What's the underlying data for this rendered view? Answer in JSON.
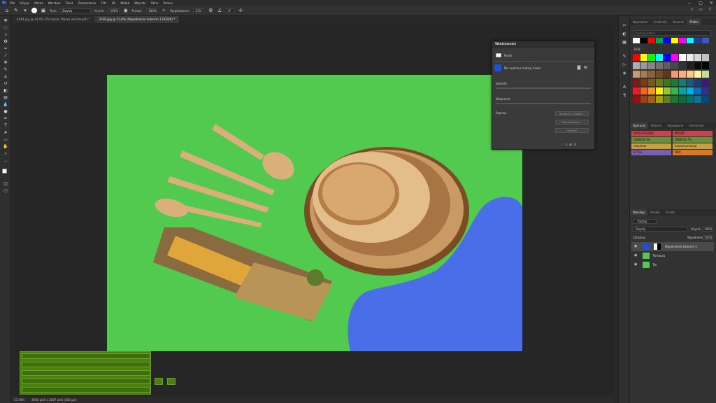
{
  "menubar": {
    "logo": "Ps",
    "items": [
      "Plik",
      "Edycja",
      "Obraz",
      "Warstwa",
      "Tekst",
      "Zaznaczenie",
      "Filtr",
      "3D",
      "Widok",
      "Wtyczki",
      "Okno",
      "Pomoc"
    ]
  },
  "window_controls": {
    "minimize": "—",
    "maximize": "▢",
    "close": "✕"
  },
  "options": {
    "tryb_label": "Tryb:",
    "tryb_value": "Zwykły",
    "krycie_label": "Krycie:",
    "krycie_value": "100%",
    "przeplyw_label": "Przepł.:",
    "przeplyw_value": "100%",
    "wygladzanie_label": "Wygładzanie:",
    "wygladzanie_value": "21%",
    "angle_value": "0°"
  },
  "tabs": [
    "4484.jpg @ 44,9% (Tło kopia, Maska warstwy/8) *",
    "3538.jpg @ 53,6% (Wypełnienie kolorem 1,RGB/8) *"
  ],
  "statusbar": {
    "zoom": "53,56%",
    "size": "4000 pikS x 2667 pikS (300 ppi)"
  },
  "properties": {
    "title": "Właściwości",
    "subtitle": "Maski",
    "mask_label": "Nie wybrano żadnej maski",
    "gestosc_label": "Gęstość:",
    "wtapianie_label": "Wtapianie:",
    "popraw_label": "Popraw:",
    "btn_zaznacz": "Zaznacz i maskuj...",
    "btn_zakres": "Zakres koloru...",
    "btn_odwroc": "Odwróć"
  },
  "swatches_panel": {
    "tabs": [
      "Najnowsze",
      "Próbki",
      "Gradienty",
      "Desenie"
    ],
    "active_tab": "Próbki",
    "search_placeholder": "Szukaj próbek",
    "group_label": "RGB",
    "top_colors": [
      "#ffffff",
      "#000000",
      "#ff0000",
      "#00a650",
      "#0000ff",
      "#ffff00",
      "#ff00ff",
      "#00ffff",
      "#1a3ea8",
      "#3a56c7"
    ],
    "grid_colors": [
      "#ff0000",
      "#ffff00",
      "#00ff00",
      "#00ffff",
      "#0000ff",
      "#ff00ff",
      "#ffffff",
      "#ebebeb",
      "#d6d6d6",
      "#c2c2c2",
      "#adadad",
      "#999999",
      "#858585",
      "#707070",
      "#5c5c5c",
      "#474747",
      "#333333",
      "#1f1f1f",
      "#0a0a0a",
      "#000000",
      "#c69c6d",
      "#a67c52",
      "#8c6239",
      "#754c24",
      "#603913",
      "#f7977a",
      "#f9ad81",
      "#fdc68a",
      "#fff79a",
      "#c4df9b",
      "#7a1b1b",
      "#7a3b1b",
      "#7a5a1b",
      "#6b7a1b",
      "#3b7a1b",
      "#1b7a3b",
      "#1b7a6b",
      "#1b5a7a",
      "#1b3b7a",
      "#3b1b7a",
      "#ed1c24",
      "#f26522",
      "#f7941d",
      "#fff200",
      "#8dc63f",
      "#39b54a",
      "#00a99d",
      "#00aeef",
      "#0072bc",
      "#2e3192",
      "#9e0b0f",
      "#a0410d",
      "#a36209",
      "#aba000",
      "#598527",
      "#1a7b30",
      "#007236",
      "#00746b",
      "#0076a3",
      "#004a80"
    ]
  },
  "actions_panel": {
    "tabs": [
      "Operacje",
      "Historia",
      "Kopiowanie",
      "Informacje"
    ],
    "active_tab": "Operacje",
    "items": [
      {
        "label": "WYOSTRZANIE",
        "color": "#c0484a"
      },
      {
        "label": "MASKA",
        "color": "#c0484a"
      },
      {
        "label": "ODBICIE 3%",
        "color": "#6a8f3a"
      },
      {
        "label": "ODBICIE 7%",
        "color": "#6a8f3a"
      },
      {
        "label": "nieprzezr",
        "color": "#c9a03a"
      },
      {
        "label": "krzywe przeciął",
        "color": "#c9a03a"
      },
      {
        "label": "STYLE",
        "color": "#7a5fb0"
      },
      {
        "label": "OKO",
        "color": "#d4782a"
      }
    ]
  },
  "layers_panel": {
    "tabs": [
      "Warstwy",
      "Kanały",
      "Ścieżki"
    ],
    "active_tab": "Warstwy",
    "filter_label": "Rodzaj",
    "blend_mode": "Zwykły",
    "opacity_label": "Krycie:",
    "opacity_value": "100%",
    "lock_label": "Zablokuj:",
    "fill_label": "Wypełnienie:",
    "fill_value": "100%",
    "layers": [
      {
        "name": "Wypełnienie kolorem 1",
        "selected": true,
        "thumb": "#1d4fd9"
      },
      {
        "name": "Tło kopia",
        "selected": false,
        "thumb": "#52c94f"
      },
      {
        "name": "Tło",
        "selected": false,
        "thumb": "#52c94f"
      }
    ]
  },
  "colors": {
    "artboard_bg": "#52c94f",
    "blue_shape": "#4a6ee8",
    "keyboard_overlay": "#4a7f11"
  }
}
